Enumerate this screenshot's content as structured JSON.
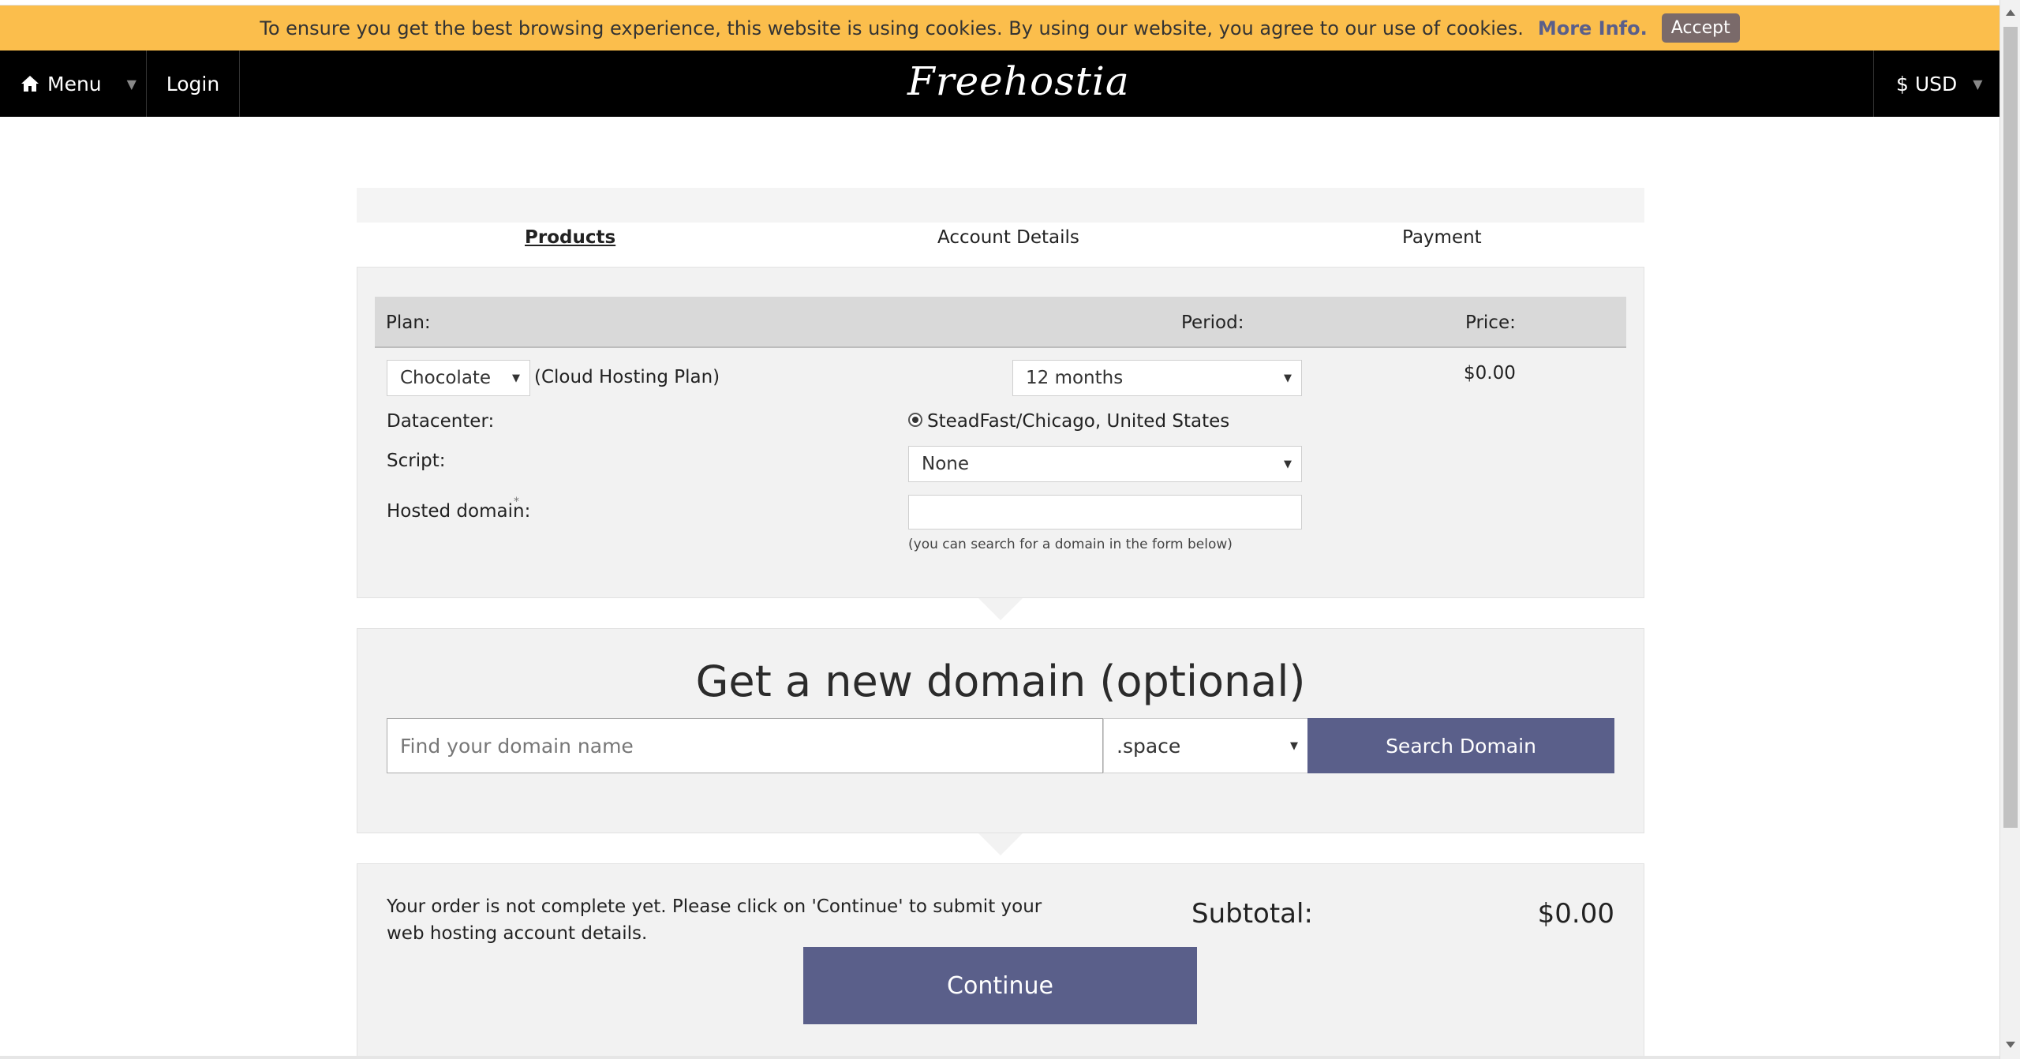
{
  "cookie": {
    "message": "To ensure you get the best browsing experience, this website is using cookies. By using our website, you agree to our use of cookies.",
    "more_info": "More Info.",
    "accept": "Accept"
  },
  "nav": {
    "menu_label": "Menu",
    "login_label": "Login",
    "logo": "Freehostia",
    "currency": "$ USD"
  },
  "steps": [
    "Products",
    "Account Details",
    "Payment"
  ],
  "plan_table": {
    "headers": {
      "plan": "Plan:",
      "period": "Period:",
      "price": "Price:"
    },
    "plan_value": "Chocolate",
    "plan_type": "(Cloud Hosting Plan)",
    "period_value": "12 months",
    "price_value": "$0.00",
    "datacenter_label": "Datacenter:",
    "datacenter_value": "SteadFast/Chicago, United States",
    "script_label": "Script:",
    "script_value": "None",
    "hosted_domain_label": "Hosted domain:",
    "required_mark": "*",
    "hosted_domain_value": "",
    "hosted_domain_hint": "(you can search for a domain in the form below)"
  },
  "domain_search": {
    "title": "Get a new domain (optional)",
    "placeholder": "Find your domain name",
    "tld": ".space",
    "button": "Search Domain"
  },
  "order": {
    "note": "Your order is not complete yet. Please click on 'Continue' to submit your web hosting account details.",
    "subtotal_label": "Subtotal:",
    "subtotal_value": "$0.00",
    "continue": "Continue"
  },
  "colors": {
    "cookie_bar": "#fbbe4c",
    "navbar": "#000000",
    "accent_button": "#5a5f8a",
    "panel": "#f2f2f2"
  },
  "icons": {
    "menu": "home-icon",
    "dropdown": "caret-down-icon"
  }
}
